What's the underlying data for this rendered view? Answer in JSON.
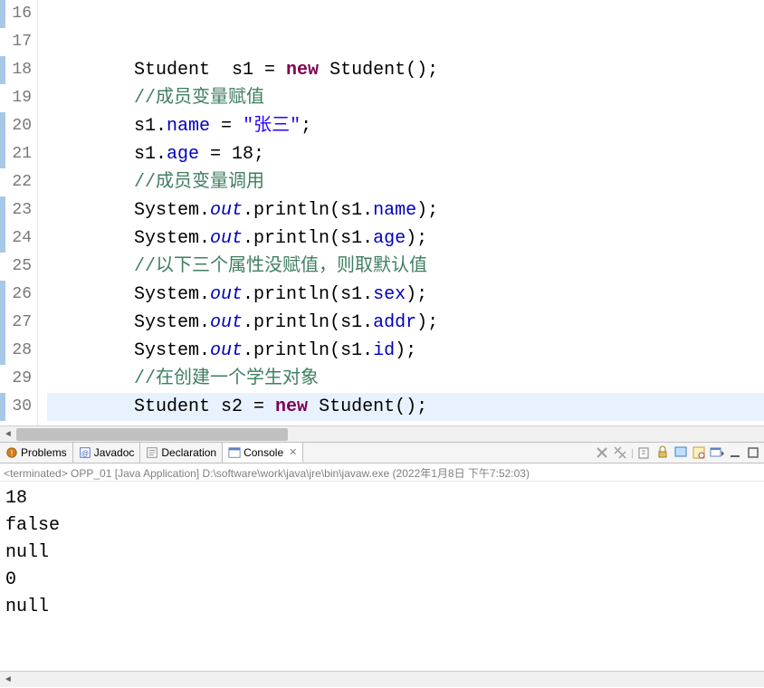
{
  "editor": {
    "lines": [
      {
        "num": "16",
        "highlight": true,
        "tokens": []
      },
      {
        "num": "17",
        "highlight": false,
        "tokens": []
      },
      {
        "num": "18",
        "highlight": true,
        "tokens": [
          {
            "t": "plain",
            "v": "        Student  s1 = "
          },
          {
            "t": "kw",
            "v": "new"
          },
          {
            "t": "plain",
            "v": " Student();"
          }
        ]
      },
      {
        "num": "19",
        "highlight": false,
        "tokens": [
          {
            "t": "plain",
            "v": "        "
          },
          {
            "t": "comment",
            "v": "//成员变量赋值"
          }
        ]
      },
      {
        "num": "20",
        "highlight": true,
        "tokens": [
          {
            "t": "plain",
            "v": "        s1."
          },
          {
            "t": "field",
            "v": "name"
          },
          {
            "t": "plain",
            "v": " = "
          },
          {
            "t": "str",
            "v": "\"张三\""
          },
          {
            "t": "plain",
            "v": ";"
          }
        ]
      },
      {
        "num": "21",
        "highlight": true,
        "tokens": [
          {
            "t": "plain",
            "v": "        s1."
          },
          {
            "t": "field",
            "v": "age"
          },
          {
            "t": "plain",
            "v": " = 18;"
          }
        ]
      },
      {
        "num": "22",
        "highlight": false,
        "tokens": [
          {
            "t": "plain",
            "v": "        "
          },
          {
            "t": "comment",
            "v": "//成员变量调用"
          }
        ]
      },
      {
        "num": "23",
        "highlight": true,
        "tokens": [
          {
            "t": "plain",
            "v": "        System."
          },
          {
            "t": "static-field",
            "v": "out"
          },
          {
            "t": "plain",
            "v": ".println(s1."
          },
          {
            "t": "field",
            "v": "name"
          },
          {
            "t": "plain",
            "v": ");"
          }
        ]
      },
      {
        "num": "24",
        "highlight": true,
        "tokens": [
          {
            "t": "plain",
            "v": "        System."
          },
          {
            "t": "static-field",
            "v": "out"
          },
          {
            "t": "plain",
            "v": ".println(s1."
          },
          {
            "t": "field",
            "v": "age"
          },
          {
            "t": "plain",
            "v": ");"
          }
        ]
      },
      {
        "num": "25",
        "highlight": false,
        "tokens": [
          {
            "t": "plain",
            "v": "        "
          },
          {
            "t": "comment",
            "v": "//以下三个属性没赋值，则取默认值"
          }
        ]
      },
      {
        "num": "26",
        "highlight": true,
        "tokens": [
          {
            "t": "plain",
            "v": "        System."
          },
          {
            "t": "static-field",
            "v": "out"
          },
          {
            "t": "plain",
            "v": ".println(s1."
          },
          {
            "t": "field",
            "v": "sex"
          },
          {
            "t": "plain",
            "v": ");"
          }
        ]
      },
      {
        "num": "27",
        "highlight": true,
        "tokens": [
          {
            "t": "plain",
            "v": "        System."
          },
          {
            "t": "static-field",
            "v": "out"
          },
          {
            "t": "plain",
            "v": ".println(s1."
          },
          {
            "t": "field",
            "v": "addr"
          },
          {
            "t": "plain",
            "v": ");"
          }
        ]
      },
      {
        "num": "28",
        "highlight": true,
        "tokens": [
          {
            "t": "plain",
            "v": "        System."
          },
          {
            "t": "static-field",
            "v": "out"
          },
          {
            "t": "plain",
            "v": ".println(s1."
          },
          {
            "t": "field",
            "v": "id"
          },
          {
            "t": "plain",
            "v": ");"
          }
        ]
      },
      {
        "num": "29",
        "highlight": false,
        "tokens": [
          {
            "t": "plain",
            "v": "        "
          },
          {
            "t": "comment",
            "v": "//在创建一个学生对象"
          }
        ]
      },
      {
        "num": "30",
        "highlight": true,
        "tokens": [
          {
            "t": "plain",
            "v": "        Student s2 = "
          },
          {
            "t": "kw",
            "v": "new"
          },
          {
            "t": "plain",
            "v": " Student();"
          }
        ],
        "currentLine": true
      }
    ]
  },
  "tabs": {
    "problems": "Problems",
    "javadoc": "Javadoc",
    "declaration": "Declaration",
    "console": "Console"
  },
  "console": {
    "header": "<terminated> OPP_01 [Java Application] D:\\software\\work\\java\\jre\\bin\\javaw.exe (2022年1月8日 下午7:52:03)",
    "output": "18\nfalse\nnull\n0\nnull"
  }
}
